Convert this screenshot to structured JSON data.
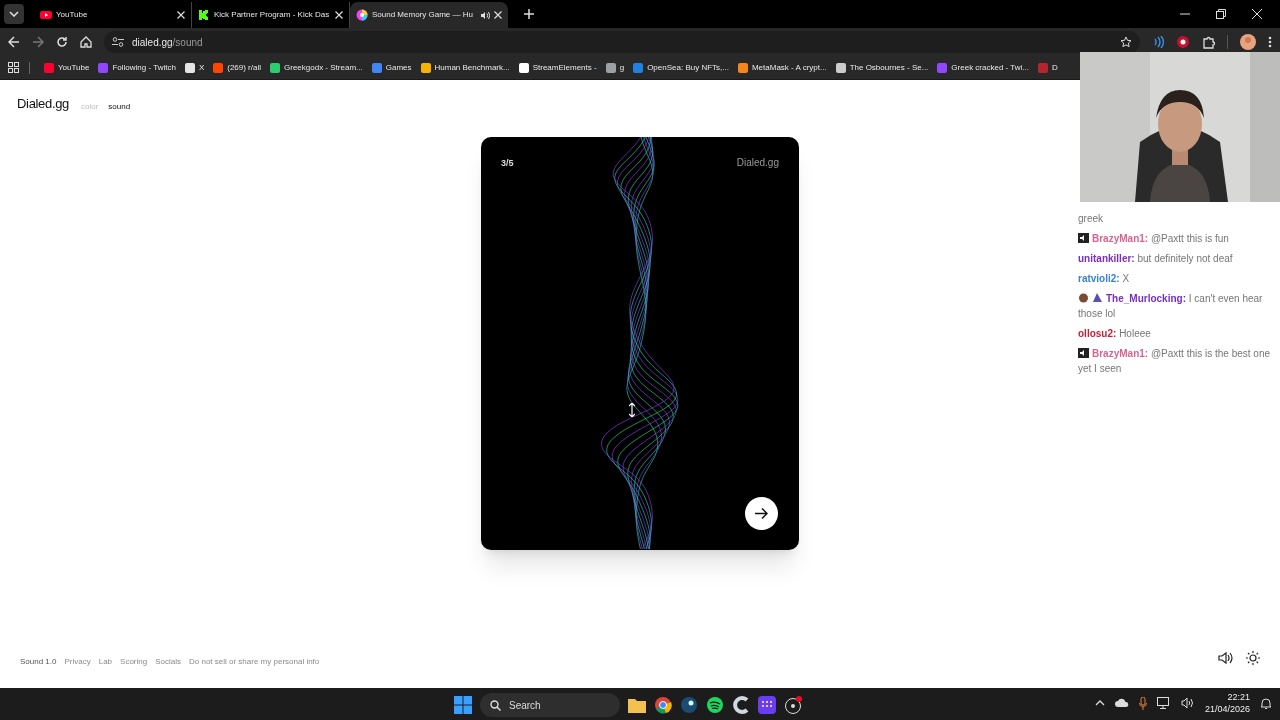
{
  "browser": {
    "tabs": [
      {
        "title": "YouTube",
        "selected": false,
        "audio": false
      },
      {
        "title": "Kick Partner Program - Kick Das",
        "selected": false,
        "audio": false
      },
      {
        "title": "Sound Memory Game — Hu",
        "selected": true,
        "audio": true
      }
    ],
    "address": {
      "host": "dialed.gg",
      "path": "/sound"
    },
    "bookmarks": [
      {
        "label": "YouTube",
        "color": "#ff0033"
      },
      {
        "label": "Following - Twitch",
        "color": "#9146ff"
      },
      {
        "label": "X",
        "color": "#e5e5e5"
      },
      {
        "label": "(269) r/all",
        "color": "#ff4500"
      },
      {
        "label": "Greekgodx - Stream...",
        "color": "#2ecc71"
      },
      {
        "label": "Games",
        "color": "#4285f4"
      },
      {
        "label": "Human Benchmark...",
        "color": "#f5b400"
      },
      {
        "label": "StreamElements -",
        "color": "#ffffff"
      },
      {
        "label": "g",
        "color": "#9aa0a6"
      },
      {
        "label": "OpenSea: Buy NFTs,...",
        "color": "#2081e2"
      },
      {
        "label": "MetaMask - A crypt...",
        "color": "#f6851b"
      },
      {
        "label": "The Osbournes - Se...",
        "color": "#cccccc"
      },
      {
        "label": "Greek cracked - Twi...",
        "color": "#9146ff"
      },
      {
        "label": "D",
        "color": "#b3262e"
      }
    ]
  },
  "page": {
    "logo": "Dialed.gg",
    "nav": [
      {
        "label": "color",
        "selected": false
      },
      {
        "label": "sound",
        "selected": true
      }
    ],
    "card": {
      "counter": "3/5",
      "brand": "Dialed.gg"
    },
    "footer": [
      {
        "label": "Sound 1.0",
        "kind": "version"
      },
      {
        "label": "Privacy",
        "kind": "link"
      },
      {
        "label": "Lab",
        "kind": "link"
      },
      {
        "label": "Scoring",
        "kind": "link"
      },
      {
        "label": "Socials",
        "kind": "link"
      },
      {
        "label": "Do not sell or share my personal info",
        "kind": "link"
      }
    ]
  },
  "chat": [
    {
      "kind": "text",
      "text": "greek"
    },
    {
      "kind": "speaker",
      "user": "BrazyMan1:",
      "color": "#d9648f",
      "text": "@Paxtt this is fun"
    },
    {
      "kind": "plain",
      "user": "unitankiller:",
      "color": "#7a2fc0",
      "text": "but definitely not deaf"
    },
    {
      "kind": "plain",
      "user": "ratvioli2:",
      "color": "#3c7fd0",
      "text": "X"
    },
    {
      "kind": "duo",
      "user": "The_Murlocking:",
      "color": "#7a2fc0",
      "text": "I can't even hear those lol"
    },
    {
      "kind": "plain",
      "user": "ollosu2:",
      "color": "#c81e3a",
      "text": "Holeee"
    },
    {
      "kind": "speaker",
      "user": "BrazyMan1:",
      "color": "#d9648f",
      "text": "@Paxtt this is the best one yet I seen"
    }
  ],
  "taskbar": {
    "search": "Search",
    "time": "22:21",
    "date": "21/04/2026"
  }
}
